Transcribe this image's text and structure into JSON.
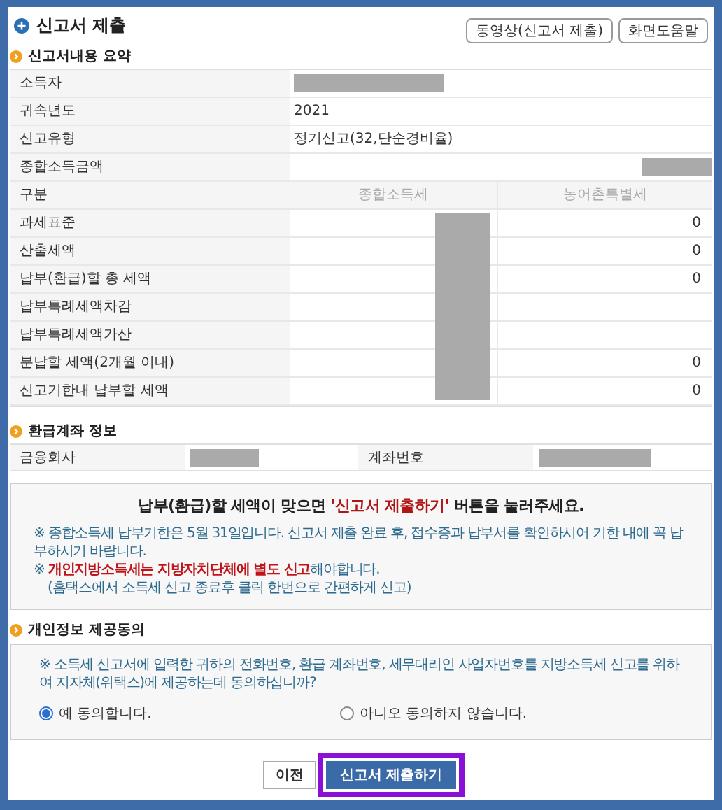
{
  "title": "신고서 제출",
  "header_buttons": [
    "동영상(신고서 제출)",
    "화면도움말"
  ],
  "summary": {
    "heading": "신고서내용 요약",
    "info_rows": [
      {
        "label": "소득자",
        "redacted": true
      },
      {
        "label": "귀속년도",
        "value": "2021"
      },
      {
        "label": "신고유형",
        "value": "정기신고(32,단순경비율)"
      },
      {
        "label": "종합소득금액",
        "redacted": true
      }
    ],
    "columns": [
      "구분",
      "종합소득세",
      "농어촌특별세"
    ],
    "amount_rows": [
      {
        "label": "과세표준",
        "rural_tax": "0"
      },
      {
        "label": "산출세액",
        "rural_tax": "0"
      },
      {
        "label": "납부(환급)할 총 세액",
        "rural_tax": "0"
      },
      {
        "label": "납부특례세액차감"
      },
      {
        "label": "납부특례세액가산"
      },
      {
        "label": "분납할 세액(2개월 이내)",
        "rural_tax": "0"
      },
      {
        "label": "신고기한내 납부할 세액",
        "rural_tax": "0"
      }
    ],
    "income_tax_redacted": true
  },
  "refund_account": {
    "heading": "환급계좌 정보",
    "fields": [
      {
        "label": "금융회사",
        "redacted": true
      },
      {
        "label": "계좌번호",
        "redacted": true
      }
    ]
  },
  "notice": {
    "headline": [
      {
        "text": "납부(환급)할 세액이 맞으면 ",
        "emphasis": false
      },
      {
        "text": "'신고서 제출하기'",
        "emphasis": true
      },
      {
        "text": " 버튼을 눌러주세요.",
        "emphasis": false
      }
    ],
    "notes": [
      [
        {
          "text": "※ 종합소득세 납부기한은 5월 31일입니다. 신고서 제출 완료 후, 접수증과 납부서를 확인하시어 기한 내에 꼭 납부하시기 바랍니다.",
          "emphasis": false
        }
      ],
      [
        {
          "text": "※ ",
          "emphasis": false
        },
        {
          "text": "개인지방소득세는 지방자치단체에 별도 신고",
          "emphasis": true
        },
        {
          "text": "해야합니다.",
          "emphasis": false
        }
      ],
      [
        {
          "text": "(홈택스에서 소득세 신고 종료후 클릭 한번으로 간편하게 신고)",
          "emphasis": false
        }
      ]
    ]
  },
  "consent": {
    "heading": "개인정보 제공동의",
    "question": "※ 소득세 신고서에 입력한 귀하의 전화번호, 환급 계좌번호, 세무대리인 사업자번호를 지방소득세 신고를 위하여 지자체(위택스)에 제공하는데 동의하십니까?",
    "options": [
      {
        "label": "예 동의합니다.",
        "selected": true
      },
      {
        "label": "아니오 동의하지 않습니다.",
        "selected": false
      }
    ]
  },
  "footer_buttons": [
    {
      "label": "이전",
      "kind": "secondary",
      "highlighted": false
    },
    {
      "label": "신고서 제출하기",
      "kind": "primary",
      "highlighted": true
    }
  ]
}
